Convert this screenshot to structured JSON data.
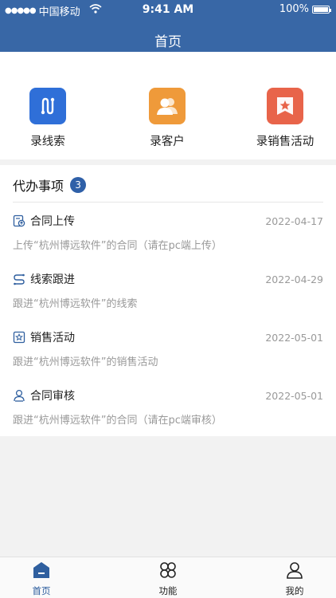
{
  "status_bar": {
    "carrier": "中国移动",
    "time": "9:41 AM",
    "battery": "100%"
  },
  "header": {
    "title": "首页"
  },
  "shortcuts": [
    {
      "label": "录线索",
      "icon": "lead-icon",
      "color": "#2f6fd8"
    },
    {
      "label": "录客户",
      "icon": "customer-icon",
      "color": "#ef9a3a"
    },
    {
      "label": "录销售活动",
      "icon": "sales-activity-icon",
      "color": "#e8644a"
    }
  ],
  "todo": {
    "title": "代办事项",
    "count": "3",
    "items": [
      {
        "name": "合同上传",
        "date": "2022-04-17",
        "desc": "上传“杭州博远软件”的合同（请在pc端上传）",
        "icon": "contract-upload-icon"
      },
      {
        "name": "线索跟进",
        "date": "2022-04-29",
        "desc": "跟进“杭州博远软件”的线索",
        "icon": "lead-followup-icon"
      },
      {
        "name": "销售活动",
        "date": "2022-05-01",
        "desc": "跟进“杭州博远软件”的销售活动",
        "icon": "sales-activity-icon"
      },
      {
        "name": "合同审核",
        "date": "2022-05-01",
        "desc": "跟进“杭州博远软件”的合同（请在pc端审核）",
        "icon": "contract-review-icon"
      }
    ]
  },
  "tabbar": {
    "tabs": [
      {
        "label": "首页",
        "icon": "home-icon",
        "active": true
      },
      {
        "label": "功能",
        "icon": "functions-icon",
        "active": false
      },
      {
        "label": "我的",
        "icon": "profile-icon",
        "active": false
      }
    ]
  },
  "colors": {
    "primary": "#3867a6",
    "accent": "#2f60a8",
    "muted": "#999999"
  }
}
